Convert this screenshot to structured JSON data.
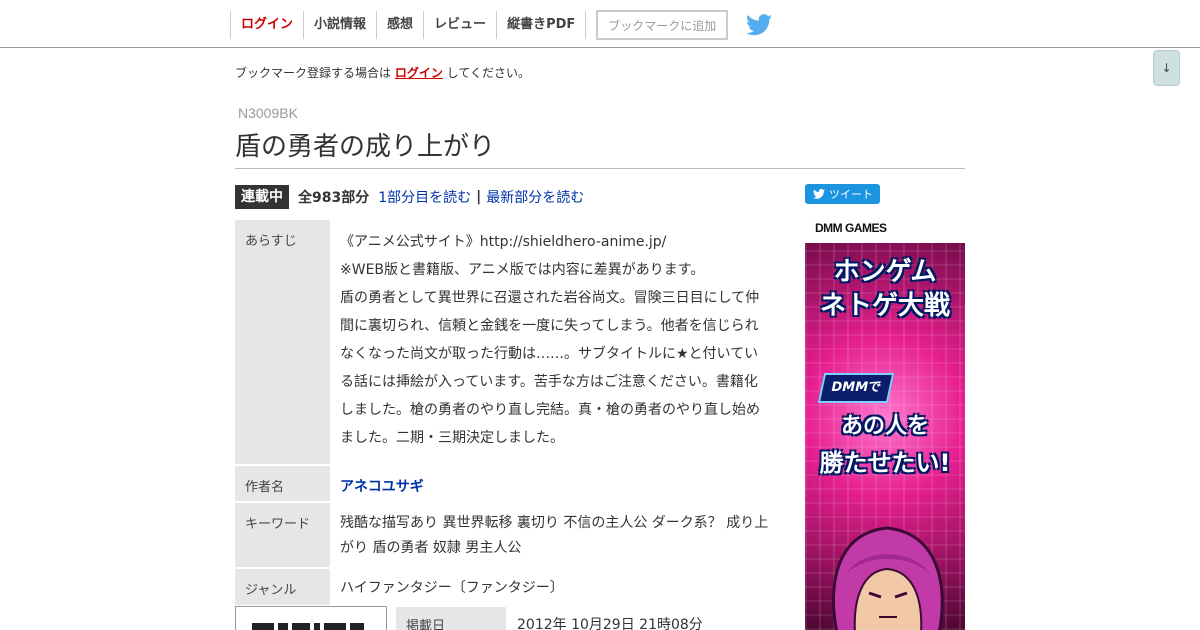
{
  "nav": {
    "items": [
      {
        "label": "ログイン"
      },
      {
        "label": "小説情報"
      },
      {
        "label": "感想"
      },
      {
        "label": "レビュー"
      },
      {
        "label": "縦書きPDF"
      }
    ],
    "bookmark_button": "ブックマークに追加",
    "twitter_icon": "twitter-bird-icon",
    "scroll_down_glyph": "↓"
  },
  "notice": {
    "before": "ブックマーク登録する場合は",
    "login_link": "ログイン",
    "after": "してください。"
  },
  "novel": {
    "ncode": "N3009BK",
    "title": "盾の勇者の成り上がり",
    "status": "連載中",
    "total_parts": "全983部分",
    "read_first": "1部分目を読む",
    "separator": "|",
    "read_latest": "最新部分を読む"
  },
  "info": {
    "synopsis_label": "あらすじ",
    "synopsis_lines": [
      "《アニメ公式サイト》http://shieldhero-anime.jp/",
      "※WEB版と書籍版、アニメ版では内容に差異があります。",
      "盾の勇者として異世界に召還された岩谷尚文。冒険三日目にして仲",
      "間に裏切られ、信頼と金銭を一度に失ってしまう。他者を信じられ",
      "なくなった尚文が取った行動は……。サブタイトルに★と付いてい",
      "る話には挿絵が入っています。苦手な方はご注意ください。書籍化",
      "しました。槍の勇者のやり直し完結。真・槍の勇者のやり直し始め",
      "ました。二期・三期決定しました。"
    ],
    "author_label": "作者名",
    "author": "アネコユサギ",
    "keyword_label": "キーワード",
    "keyword_lines": [
      "残酷な描写あり 異世界転移  裏切り 不信の主人公 ダーク系？ 成り上",
      "がり 盾の勇者 奴隷 男主人公"
    ],
    "genre_label": "ジャンル",
    "genre": "ハイファンタジー〔ファンタジー〕",
    "date_label": "掲載日",
    "date": "2012年 10月29日 21時08分"
  },
  "sidebar": {
    "tweet_label": "ツイート",
    "ad": {
      "logo": "DMM GAMES",
      "game_title_line1": "ホンゲム",
      "game_title_line2": "ネトゲ大戦",
      "badge": "DMMで",
      "line1": "あの人を",
      "line2": "勝たせたい!"
    }
  },
  "colors": {
    "accent_red": "#cc0000",
    "link_blue": "#0033aa",
    "label_bg": "#e6e6e6",
    "status_bg": "#333333",
    "twitter_blue": "#1b95e0",
    "ad_pink": "#e61f8f"
  }
}
